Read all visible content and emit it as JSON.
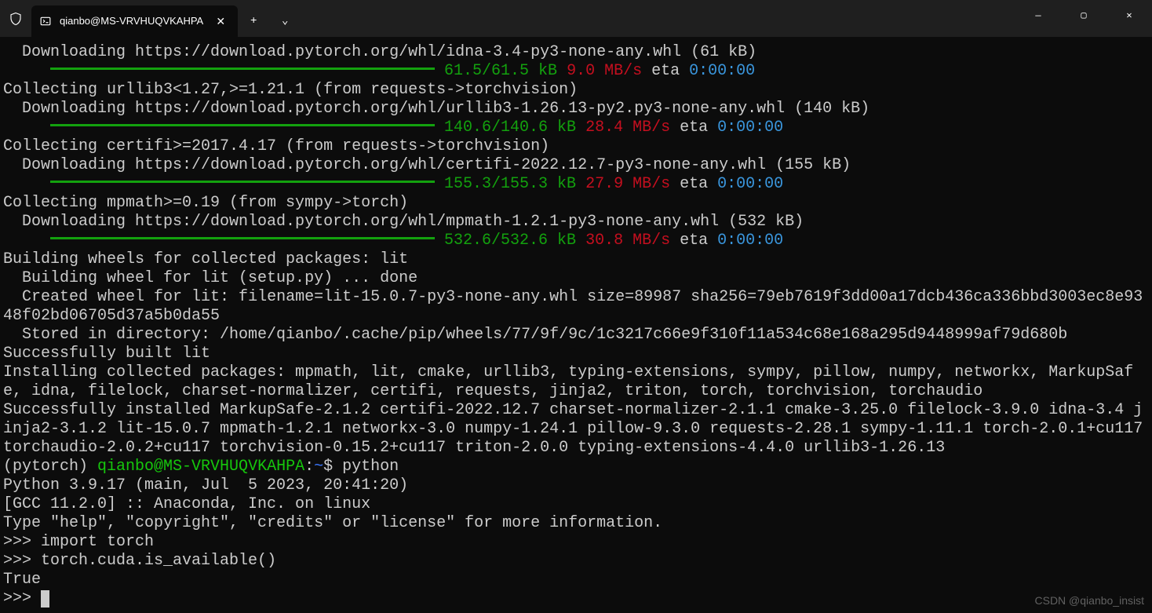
{
  "titlebar": {
    "tab_title": "qianbo@MS-VRVHUQVKAHPA",
    "close_glyph": "✕",
    "add_glyph": "+",
    "drop_glyph": "⌄"
  },
  "window_controls": {
    "minimize": "—",
    "maximize": "▢",
    "close": "✕"
  },
  "downloads": [
    {
      "url_line": "  Downloading https://download.pytorch.org/whl/idna-3.4-py3-none-any.whl (61 kB)",
      "progress": "61.5/61.5 kB",
      "speed": "9.0 MB/s",
      "eta_label": " eta ",
      "eta": "0:00:00"
    },
    {
      "collect_line": "Collecting urllib3<1.27,>=1.21.1 (from requests->torchvision)",
      "url_line": "  Downloading https://download.pytorch.org/whl/urllib3-1.26.13-py2.py3-none-any.whl (140 kB)",
      "progress": "140.6/140.6 kB",
      "speed": "28.4 MB/s",
      "eta_label": " eta ",
      "eta": "0:00:00"
    },
    {
      "collect_line": "Collecting certifi>=2017.4.17 (from requests->torchvision)",
      "url_line": "  Downloading https://download.pytorch.org/whl/certifi-2022.12.7-py3-none-any.whl (155 kB)",
      "progress": "155.3/155.3 kB",
      "speed": "27.9 MB/s",
      "eta_label": " eta ",
      "eta": "0:00:00"
    },
    {
      "collect_line": "Collecting mpmath>=0.19 (from sympy->torch)",
      "url_line": "  Downloading https://download.pytorch.org/whl/mpmath-1.2.1-py3-none-any.whl (532 kB)",
      "progress": "532.6/532.6 kB",
      "speed": "30.8 MB/s",
      "eta_label": " eta ",
      "eta": "0:00:00"
    }
  ],
  "build": {
    "header": "Building wheels for collected packages: lit",
    "building": "  Building wheel for lit (setup.py) ... done",
    "created": "  Created wheel for lit: filename=lit-15.0.7-py3-none-any.whl size=89987 sha256=79eb7619f3dd00a17dcb436ca336bbd3003ec8e9348f02bd06705d37a5b0da55",
    "stored": "  Stored in directory: /home/qianbo/.cache/pip/wheels/77/9f/9c/1c3217c66e9f310f11a534c68e168a295d9448999af79d680b",
    "success": "Successfully built lit"
  },
  "install": {
    "installing": "Installing collected packages: mpmath, lit, cmake, urllib3, typing-extensions, sympy, pillow, numpy, networkx, MarkupSafe, idna, filelock, charset-normalizer, certifi, requests, jinja2, triton, torch, torchvision, torchaudio",
    "installed": "Successfully installed MarkupSafe-2.1.2 certifi-2022.12.7 charset-normalizer-2.1.1 cmake-3.25.0 filelock-3.9.0 idna-3.4 jinja2-3.1.2 lit-15.0.7 mpmath-1.2.1 networkx-3.0 numpy-1.24.1 pillow-9.3.0 requests-2.28.1 sympy-1.11.1 torch-2.0.1+cu117 torchaudio-2.0.2+cu117 torchvision-0.15.2+cu117 triton-2.0.0 typing-extensions-4.4.0 urllib3-1.26.13"
  },
  "prompt": {
    "env": "(pytorch) ",
    "userhost": "qianbo@MS-VRVHUQVKAHPA",
    "colon": ":",
    "path": "~",
    "dollar": "$ ",
    "cmd": "python"
  },
  "python": {
    "version": "Python 3.9.17 (main, Jul  5 2023, 20:41:20)",
    "gcc": "[GCC 11.2.0] :: Anaconda, Inc. on linux",
    "help": "Type \"help\", \"copyright\", \"credits\" or \"license\" for more information.",
    "p1": ">>> ",
    "l1": "import torch",
    "l2": "torch.cuda.is_available()",
    "result": "True"
  },
  "watermark": "CSDN @qianbo_insist"
}
